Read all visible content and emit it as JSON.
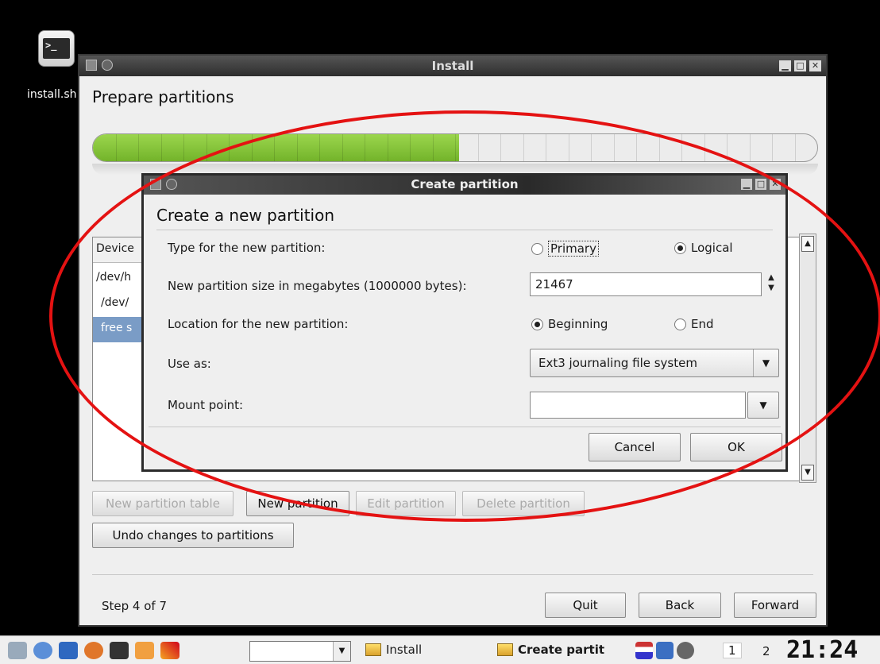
{
  "desktop": {
    "icon_label": "install.sh"
  },
  "window": {
    "title": "Install",
    "heading": "Prepare partitions",
    "progress": 0.505,
    "progress_segments": 32
  },
  "table": {
    "header": "Device",
    "rows": [
      "/dev/h",
      "  /dev/",
      "  free s"
    ],
    "selected_index": 2
  },
  "buttons": {
    "new_table": "New partition table",
    "new_partition": "New partition",
    "edit_partition": "Edit partition",
    "delete_partition": "Delete partition",
    "undo": "Undo changes to partitions",
    "quit": "Quit",
    "back": "Back",
    "forward": "Forward"
  },
  "step": "Step 4 of 7",
  "dialog": {
    "title": "Create partition",
    "heading": "Create a new partition",
    "type_label": "Type for the new partition:",
    "type_primary": "Primary",
    "type_logical": "Logical",
    "type_selected": "Logical",
    "size_label": "New partition size in megabytes (1000000 bytes):",
    "size_value": "21467",
    "location_label": "Location for the new partition:",
    "loc_beginning": "Beginning",
    "loc_end": "End",
    "loc_selected": "Beginning",
    "use_as_label": "Use as:",
    "use_as_value": "Ext3 journaling file system",
    "mount_label": "Mount point:",
    "mount_value": "",
    "cancel": "Cancel",
    "ok": "OK"
  },
  "annotation": {
    "color": "#e41212"
  },
  "taskbar": {
    "task_install": "Install",
    "task_create": "Create partit",
    "workspace_1": "1",
    "workspace_2": "2",
    "clock": "21:24"
  }
}
